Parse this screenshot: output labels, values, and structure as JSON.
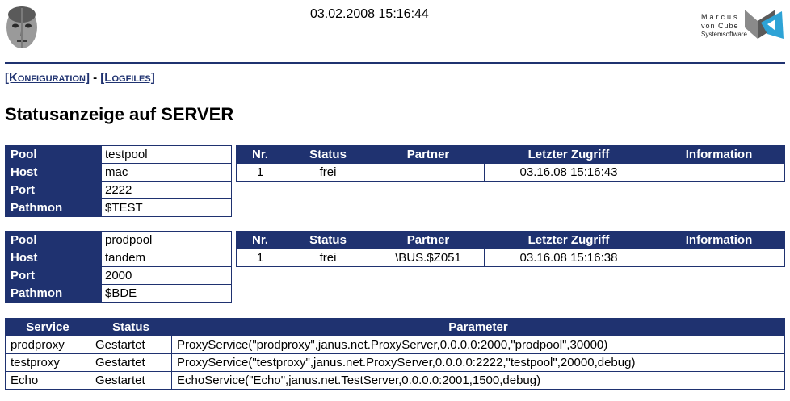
{
  "header": {
    "datetime": "03.02.2008 15:16:44",
    "logo_line1": "Marcus",
    "logo_line2": "von Cube",
    "logo_line3": "Systemsoftware"
  },
  "nav": {
    "link_config": "[Konfiguration]",
    "separator": "-",
    "link_logfiles": "[Logfiles]"
  },
  "page_title": "Statusanzeige auf SERVER",
  "labels": {
    "pool": "Pool",
    "host": "Host",
    "port": "Port",
    "pathmon": "Pathmon"
  },
  "conn_headers": [
    "Nr.",
    "Status",
    "Partner",
    "Letzter Zugriff",
    "Information"
  ],
  "pools": [
    {
      "pool": "testpool",
      "host": "mac",
      "port": "2222",
      "pathmon": "$TEST",
      "rows": [
        {
          "nr": "1",
          "status": "frei",
          "partner": "",
          "last_access": "03.16.08 15:16:43",
          "information": ""
        }
      ]
    },
    {
      "pool": "prodpool",
      "host": "tandem",
      "port": "2000",
      "pathmon": "$BDE",
      "rows": [
        {
          "nr": "1",
          "status": "frei",
          "partner": "\\BUS.$Z051",
          "last_access": "03.16.08 15:16:38",
          "information": ""
        }
      ]
    }
  ],
  "services": {
    "headers": [
      "Service",
      "Status",
      "Parameter"
    ],
    "rows": [
      {
        "service": "prodproxy",
        "status": "Gestartet",
        "parameter": "ProxyService(\"prodproxy\",janus.net.ProxyServer,0.0.0.0:2000,\"prodpool\",30000)"
      },
      {
        "service": "testproxy",
        "status": "Gestartet",
        "parameter": "ProxyService(\"testproxy\",janus.net.ProxyServer,0.0.0.0:2222,\"testpool\",20000,debug)"
      },
      {
        "service": "Echo",
        "status": "Gestartet",
        "parameter": "EchoService(\"Echo\",janus.net.TestServer,0.0.0.0:2001,1500,debug)"
      }
    ]
  },
  "colors": {
    "accent": "#1f3270",
    "background": "#ffffff"
  }
}
